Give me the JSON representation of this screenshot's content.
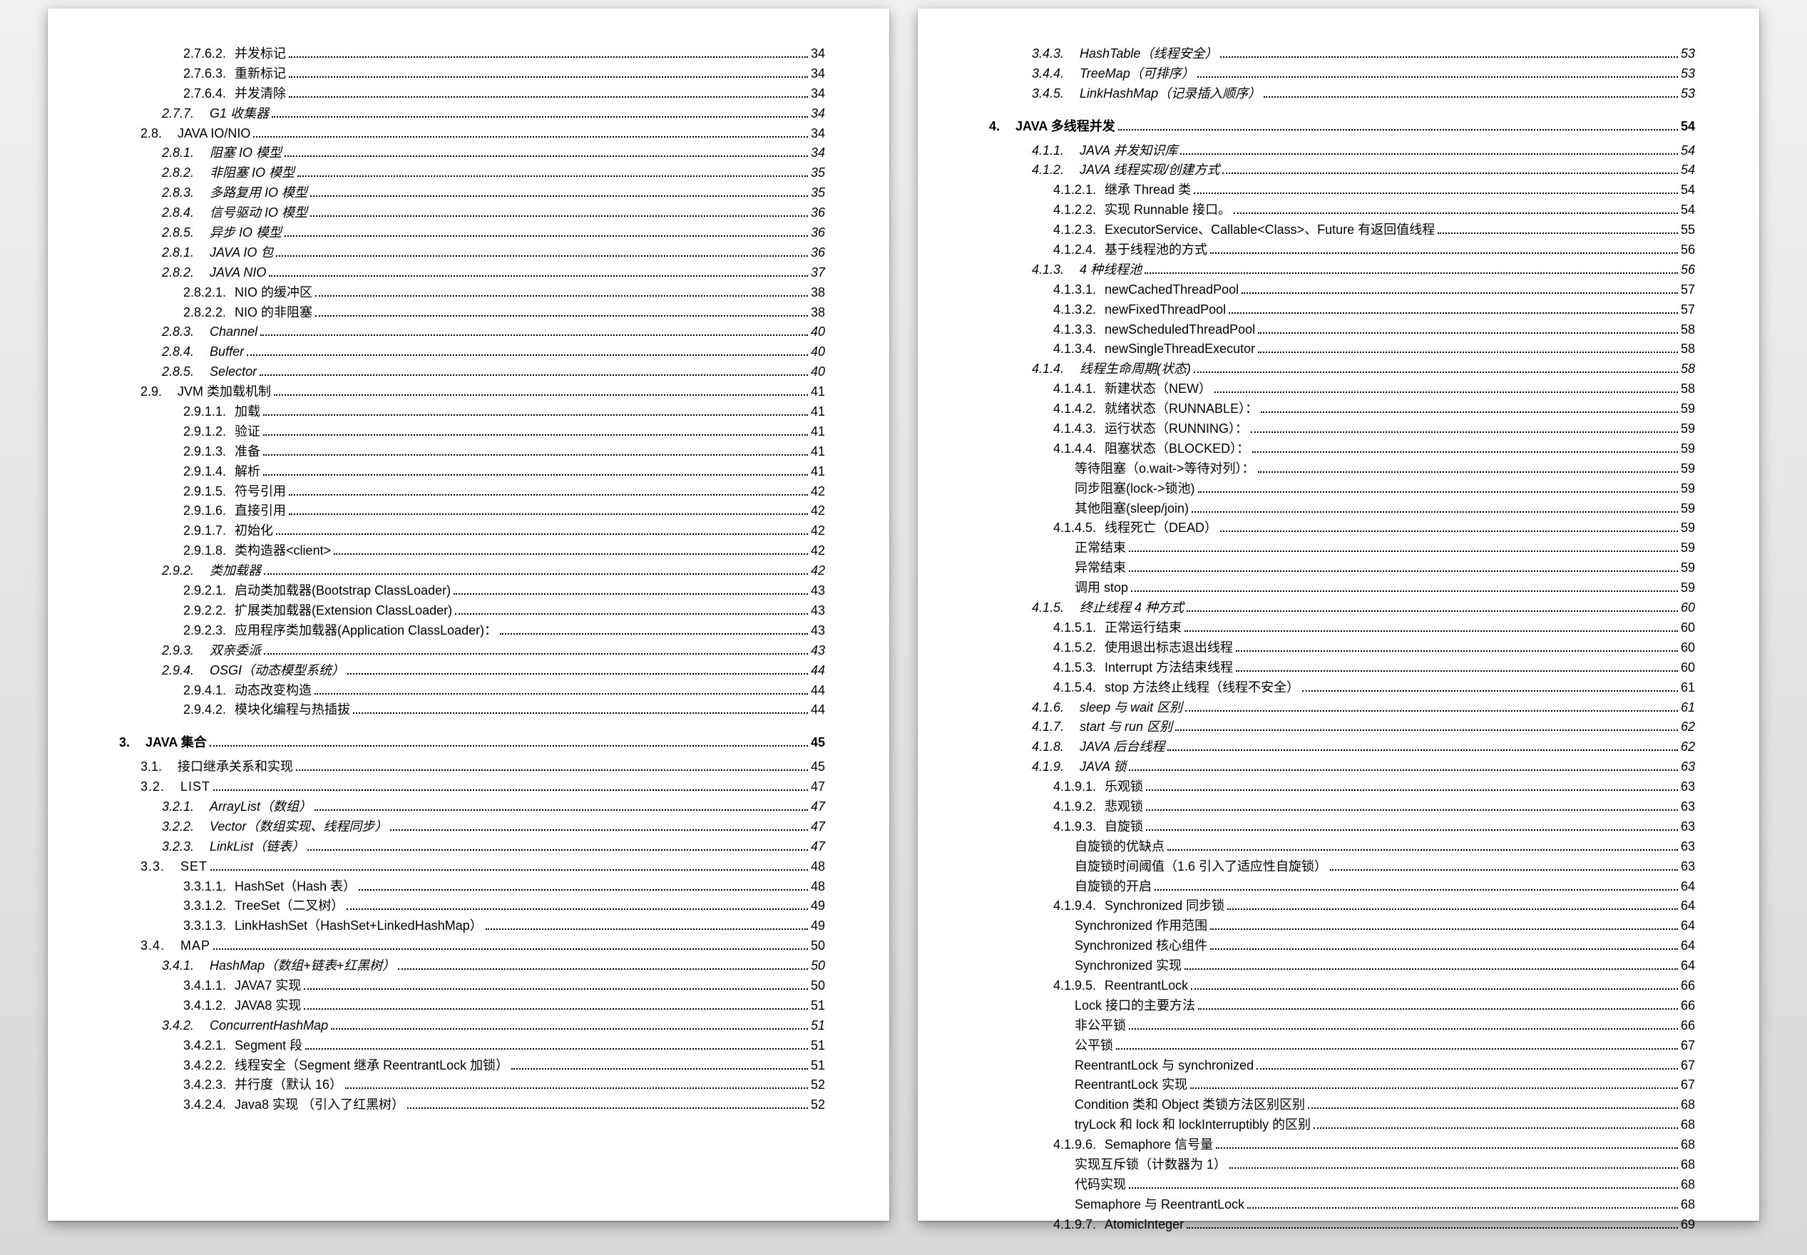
{
  "left": [
    {
      "indent": 3,
      "num": "2.7.6.2.",
      "label": "并发标记",
      "page": "34",
      "italic": false,
      "bold": false
    },
    {
      "indent": 3,
      "num": "2.7.6.3.",
      "label": "重新标记",
      "page": "34",
      "italic": false,
      "bold": false
    },
    {
      "indent": 3,
      "num": "2.7.6.4.",
      "label": "并发清除",
      "page": "34",
      "italic": false,
      "bold": false
    },
    {
      "indent": 2,
      "num": "2.7.7.",
      "label": "G1 收集器",
      "page": "34",
      "italic": true,
      "bold": false
    },
    {
      "indent": 1,
      "num": "2.8.",
      "label": "JAVA IO/NIO",
      "page": "34",
      "italic": false,
      "bold": false
    },
    {
      "indent": 2,
      "num": "2.8.1.",
      "label": "阻塞 IO 模型",
      "page": "34",
      "italic": true,
      "bold": false
    },
    {
      "indent": 2,
      "num": "2.8.2.",
      "label": "非阻塞 IO 模型",
      "page": "35",
      "italic": true,
      "bold": false
    },
    {
      "indent": 2,
      "num": "2.8.3.",
      "label": "多路复用 IO 模型",
      "page": "35",
      "italic": true,
      "bold": false
    },
    {
      "indent": 2,
      "num": "2.8.4.",
      "label": "信号驱动 IO 模型",
      "page": "36",
      "italic": true,
      "bold": false
    },
    {
      "indent": 2,
      "num": "2.8.5.",
      "label": "异步 IO 模型",
      "page": "36",
      "italic": true,
      "bold": false
    },
    {
      "indent": 2,
      "num": "2.8.1.",
      "label": "JAVA IO 包",
      "page": "36",
      "italic": true,
      "bold": false
    },
    {
      "indent": 2,
      "num": "2.8.2.",
      "label": "JAVA NIO",
      "page": "37",
      "italic": true,
      "bold": false
    },
    {
      "indent": 3,
      "num": "2.8.2.1.",
      "label": "NIO 的缓冲区",
      "page": "38",
      "italic": false,
      "bold": false
    },
    {
      "indent": 3,
      "num": "2.8.2.2.",
      "label": "NIO 的非阻塞",
      "page": "38",
      "italic": false,
      "bold": false
    },
    {
      "indent": 2,
      "num": "2.8.3.",
      "label": "Channel",
      "page": "40",
      "italic": true,
      "bold": false
    },
    {
      "indent": 2,
      "num": "2.8.4.",
      "label": "Buffer",
      "page": "40",
      "italic": true,
      "bold": false
    },
    {
      "indent": 2,
      "num": "2.8.5.",
      "label": "Selector",
      "page": "40",
      "italic": true,
      "bold": false
    },
    {
      "indent": 1,
      "num": "2.9.",
      "label": "JVM 类加载机制",
      "page": "41",
      "italic": false,
      "bold": false
    },
    {
      "indent": 3,
      "num": "2.9.1.1.",
      "label": "加载",
      "page": "41",
      "italic": false,
      "bold": false
    },
    {
      "indent": 3,
      "num": "2.9.1.2.",
      "label": "验证",
      "page": "41",
      "italic": false,
      "bold": false
    },
    {
      "indent": 3,
      "num": "2.9.1.3.",
      "label": "准备",
      "page": "41",
      "italic": false,
      "bold": false
    },
    {
      "indent": 3,
      "num": "2.9.1.4.",
      "label": "解析",
      "page": "41",
      "italic": false,
      "bold": false
    },
    {
      "indent": 3,
      "num": "2.9.1.5.",
      "label": "符号引用",
      "page": "42",
      "italic": false,
      "bold": false
    },
    {
      "indent": 3,
      "num": "2.9.1.6.",
      "label": "直接引用",
      "page": "42",
      "italic": false,
      "bold": false
    },
    {
      "indent": 3,
      "num": "2.9.1.7.",
      "label": "初始化",
      "page": "42",
      "italic": false,
      "bold": false
    },
    {
      "indent": 3,
      "num": "2.9.1.8.",
      "label": "类构造器<client>",
      "page": "42",
      "italic": false,
      "bold": false
    },
    {
      "indent": 2,
      "num": "2.9.2.",
      "label": "类加载器",
      "page": "42",
      "italic": true,
      "bold": false
    },
    {
      "indent": 3,
      "num": "2.9.2.1.",
      "label": "启动类加载器(Bootstrap ClassLoader)",
      "page": "43",
      "italic": false,
      "bold": false
    },
    {
      "indent": 3,
      "num": "2.9.2.2.",
      "label": "扩展类加载器(Extension ClassLoader)",
      "page": "43",
      "italic": false,
      "bold": false
    },
    {
      "indent": 3,
      "num": "2.9.2.3.",
      "label": "应用程序类加载器(Application ClassLoader)：",
      "page": "43",
      "italic": false,
      "bold": false
    },
    {
      "indent": 2,
      "num": "2.9.3.",
      "label": "双亲委派",
      "page": "43",
      "italic": true,
      "bold": false
    },
    {
      "indent": 2,
      "num": "2.9.4.",
      "label": "OSGI（动态模型系统）",
      "page": "44",
      "italic": true,
      "bold": false
    },
    {
      "indent": 3,
      "num": "2.9.4.1.",
      "label": "动态改变构造",
      "page": "44",
      "italic": false,
      "bold": false
    },
    {
      "indent": 3,
      "num": "2.9.4.2.",
      "label": "模块化编程与热插拔",
      "page": "44",
      "italic": false,
      "bold": false
    },
    {
      "indent": 0,
      "num": "3.",
      "label": "JAVA 集合",
      "page": "45",
      "italic": false,
      "bold": true
    },
    {
      "indent": 1,
      "num": "3.1.",
      "label": "接口继承关系和实现",
      "page": "45",
      "italic": false,
      "bold": false
    },
    {
      "indent": 1,
      "num": "3.2.",
      "label": "LIST",
      "page": "47",
      "italic": false,
      "bold": false,
      "smallcaps": true
    },
    {
      "indent": 2,
      "num": "3.2.1.",
      "label": "ArrayList（数组）",
      "page": "47",
      "italic": true,
      "bold": false
    },
    {
      "indent": 2,
      "num": "3.2.2.",
      "label": "Vector（数组实现、线程同步）",
      "page": "47",
      "italic": true,
      "bold": false
    },
    {
      "indent": 2,
      "num": "3.2.3.",
      "label": "LinkList（链表）",
      "page": "47",
      "italic": true,
      "bold": false
    },
    {
      "indent": 1,
      "num": "3.3.",
      "label": "SET",
      "page": "48",
      "italic": false,
      "bold": false,
      "smallcaps": true
    },
    {
      "indent": 3,
      "num": "3.3.1.1.",
      "label": "HashSet（Hash 表）",
      "page": "48",
      "italic": false,
      "bold": false
    },
    {
      "indent": 3,
      "num": "3.3.1.2.",
      "label": "TreeSet（二叉树）",
      "page": "49",
      "italic": false,
      "bold": false
    },
    {
      "indent": 3,
      "num": "3.3.1.3.",
      "label": "LinkHashSet（HashSet+LinkedHashMap）",
      "page": "49",
      "italic": false,
      "bold": false
    },
    {
      "indent": 1,
      "num": "3.4.",
      "label": "MAP",
      "page": "50",
      "italic": false,
      "bold": false,
      "smallcaps": true
    },
    {
      "indent": 2,
      "num": "3.4.1.",
      "label": "HashMap（数组+链表+红黑树）",
      "page": "50",
      "italic": true,
      "bold": false
    },
    {
      "indent": 3,
      "num": "3.4.1.1.",
      "label": "JAVA7 实现",
      "page": "50",
      "italic": false,
      "bold": false
    },
    {
      "indent": 3,
      "num": "3.4.1.2.",
      "label": "JAVA8 实现",
      "page": "51",
      "italic": false,
      "bold": false
    },
    {
      "indent": 2,
      "num": "3.4.2.",
      "label": "ConcurrentHashMap",
      "page": "51",
      "italic": true,
      "bold": false
    },
    {
      "indent": 3,
      "num": "3.4.2.1.",
      "label": "Segment 段",
      "page": "51",
      "italic": false,
      "bold": false
    },
    {
      "indent": 3,
      "num": "3.4.2.2.",
      "label": "线程安全（Segment 继承 ReentrantLock 加锁）",
      "page": "51",
      "italic": false,
      "bold": false
    },
    {
      "indent": 3,
      "num": "3.4.2.3.",
      "label": "并行度（默认 16）",
      "page": "52",
      "italic": false,
      "bold": false
    },
    {
      "indent": 3,
      "num": "3.4.2.4.",
      "label": "Java8 实现 （引入了红黑树）",
      "page": "52",
      "italic": false,
      "bold": false
    }
  ],
  "right": [
    {
      "indent": 2,
      "num": "3.4.3.",
      "label": "HashTable（线程安全）",
      "page": "53",
      "italic": true,
      "bold": false
    },
    {
      "indent": 2,
      "num": "3.4.4.",
      "label": "TreeMap（可排序）",
      "page": "53",
      "italic": true,
      "bold": false
    },
    {
      "indent": 2,
      "num": "3.4.5.",
      "label": "LinkHashMap（记录插入顺序）",
      "page": "53",
      "italic": true,
      "bold": false
    },
    {
      "indent": 0,
      "num": "4.",
      "label": "JAVA 多线程并发",
      "page": "54",
      "italic": false,
      "bold": true
    },
    {
      "indent": 2,
      "num": "4.1.1.",
      "label": "JAVA 并发知识库",
      "page": "54",
      "italic": true,
      "bold": false
    },
    {
      "indent": 2,
      "num": "4.1.2.",
      "label": "JAVA 线程实现/创建方式",
      "page": "54",
      "italic": true,
      "bold": false
    },
    {
      "indent": 3,
      "num": "4.1.2.1.",
      "label": "继承 Thread 类",
      "page": "54",
      "italic": false,
      "bold": false
    },
    {
      "indent": 3,
      "num": "4.1.2.2.",
      "label": "实现 Runnable 接口。",
      "page": "54",
      "italic": false,
      "bold": false
    },
    {
      "indent": 3,
      "num": "4.1.2.3.",
      "label": "ExecutorService、Callable<Class>、Future 有返回值线程",
      "page": "55",
      "italic": false,
      "bold": false
    },
    {
      "indent": 3,
      "num": "4.1.2.4.",
      "label": "基于线程池的方式",
      "page": "56",
      "italic": false,
      "bold": false
    },
    {
      "indent": 2,
      "num": "4.1.3.",
      "label": "4 种线程池",
      "page": "56",
      "italic": true,
      "bold": false
    },
    {
      "indent": 3,
      "num": "4.1.3.1.",
      "label": "newCachedThreadPool",
      "page": "57",
      "italic": false,
      "bold": false
    },
    {
      "indent": 3,
      "num": "4.1.3.2.",
      "label": "newFixedThreadPool",
      "page": "57",
      "italic": false,
      "bold": false
    },
    {
      "indent": 3,
      "num": "4.1.3.3.",
      "label": "newScheduledThreadPool",
      "page": "58",
      "italic": false,
      "bold": false
    },
    {
      "indent": 3,
      "num": "4.1.3.4.",
      "label": "newSingleThreadExecutor",
      "page": "58",
      "italic": false,
      "bold": false
    },
    {
      "indent": 2,
      "num": "4.1.4.",
      "label": "线程生命周期(状态)",
      "page": "58",
      "italic": true,
      "bold": false
    },
    {
      "indent": 3,
      "num": "4.1.4.1.",
      "label": "新建状态（NEW）",
      "page": "58",
      "italic": false,
      "bold": false
    },
    {
      "indent": 3,
      "num": "4.1.4.2.",
      "label": "就绪状态（RUNNABLE）：",
      "page": "59",
      "italic": false,
      "bold": false
    },
    {
      "indent": 3,
      "num": "4.1.4.3.",
      "label": "运行状态（RUNNING）：",
      "page": "59",
      "italic": false,
      "bold": false
    },
    {
      "indent": 3,
      "num": "4.1.4.4.",
      "label": "阻塞状态（BLOCKED）：",
      "page": "59",
      "italic": false,
      "bold": false
    },
    {
      "indent": 4,
      "num": "",
      "label": "等待阻塞（o.wait->等待对列）：",
      "page": "59",
      "italic": false,
      "bold": false
    },
    {
      "indent": 4,
      "num": "",
      "label": "同步阻塞(lock->锁池)",
      "page": "59",
      "italic": false,
      "bold": false
    },
    {
      "indent": 4,
      "num": "",
      "label": "其他阻塞(sleep/join)",
      "page": "59",
      "italic": false,
      "bold": false
    },
    {
      "indent": 3,
      "num": "4.1.4.5.",
      "label": "线程死亡（DEAD）",
      "page": "59",
      "italic": false,
      "bold": false
    },
    {
      "indent": 4,
      "num": "",
      "label": "正常结束",
      "page": "59",
      "italic": false,
      "bold": false
    },
    {
      "indent": 4,
      "num": "",
      "label": "异常结束",
      "page": "59",
      "italic": false,
      "bold": false
    },
    {
      "indent": 4,
      "num": "",
      "label": "调用 stop",
      "page": "59",
      "italic": false,
      "bold": false
    },
    {
      "indent": 2,
      "num": "4.1.5.",
      "label": "终止线程 4 种方式",
      "page": "60",
      "italic": true,
      "bold": false
    },
    {
      "indent": 3,
      "num": "4.1.5.1.",
      "label": "正常运行结束",
      "page": "60",
      "italic": false,
      "bold": false
    },
    {
      "indent": 3,
      "num": "4.1.5.2.",
      "label": "使用退出标志退出线程",
      "page": "60",
      "italic": false,
      "bold": false
    },
    {
      "indent": 3,
      "num": "4.1.5.3.",
      "label": "Interrupt 方法结束线程",
      "page": "60",
      "italic": false,
      "bold": false
    },
    {
      "indent": 3,
      "num": "4.1.5.4.",
      "label": "stop 方法终止线程（线程不安全）",
      "page": "61",
      "italic": false,
      "bold": false
    },
    {
      "indent": 2,
      "num": "4.1.6.",
      "label": "sleep 与 wait 区别",
      "page": "61",
      "italic": true,
      "bold": false
    },
    {
      "indent": 2,
      "num": "4.1.7.",
      "label": "start 与 run 区别",
      "page": "62",
      "italic": true,
      "bold": false
    },
    {
      "indent": 2,
      "num": "4.1.8.",
      "label": "JAVA 后台线程",
      "page": "62",
      "italic": true,
      "bold": false
    },
    {
      "indent": 2,
      "num": "4.1.9.",
      "label": "JAVA 锁",
      "page": "63",
      "italic": true,
      "bold": false
    },
    {
      "indent": 3,
      "num": "4.1.9.1.",
      "label": "乐观锁",
      "page": "63",
      "italic": false,
      "bold": false
    },
    {
      "indent": 3,
      "num": "4.1.9.2.",
      "label": "悲观锁",
      "page": "63",
      "italic": false,
      "bold": false
    },
    {
      "indent": 3,
      "num": "4.1.9.3.",
      "label": "自旋锁",
      "page": "63",
      "italic": false,
      "bold": false
    },
    {
      "indent": 4,
      "num": "",
      "label": "自旋锁的优缺点",
      "page": "63",
      "italic": false,
      "bold": false
    },
    {
      "indent": 4,
      "num": "",
      "label": "自旋锁时间阈值（1.6 引入了适应性自旋锁）",
      "page": "63",
      "italic": false,
      "bold": false
    },
    {
      "indent": 4,
      "num": "",
      "label": "自旋锁的开启",
      "page": "64",
      "italic": false,
      "bold": false
    },
    {
      "indent": 3,
      "num": "4.1.9.4.",
      "label": "Synchronized 同步锁",
      "page": "64",
      "italic": false,
      "bold": false
    },
    {
      "indent": 4,
      "num": "",
      "label": "Synchronized 作用范围",
      "page": "64",
      "italic": false,
      "bold": false
    },
    {
      "indent": 4,
      "num": "",
      "label": "Synchronized 核心组件",
      "page": "64",
      "italic": false,
      "bold": false
    },
    {
      "indent": 4,
      "num": "",
      "label": "Synchronized 实现",
      "page": "64",
      "italic": false,
      "bold": false
    },
    {
      "indent": 3,
      "num": "4.1.9.5.",
      "label": "ReentrantLock",
      "page": "66",
      "italic": false,
      "bold": false
    },
    {
      "indent": 4,
      "num": "",
      "label": "Lock 接口的主要方法",
      "page": "66",
      "italic": false,
      "bold": false
    },
    {
      "indent": 4,
      "num": "",
      "label": "非公平锁",
      "page": "66",
      "italic": false,
      "bold": false
    },
    {
      "indent": 4,
      "num": "",
      "label": "公平锁",
      "page": "67",
      "italic": false,
      "bold": false
    },
    {
      "indent": 4,
      "num": "",
      "label": "ReentrantLock 与 synchronized",
      "page": "67",
      "italic": false,
      "bold": false
    },
    {
      "indent": 4,
      "num": "",
      "label": "ReentrantLock 实现",
      "page": "67",
      "italic": false,
      "bold": false
    },
    {
      "indent": 4,
      "num": "",
      "label": "Condition 类和 Object 类锁方法区别区别",
      "page": "68",
      "italic": false,
      "bold": false
    },
    {
      "indent": 4,
      "num": "",
      "label": "tryLock 和 lock 和 lockInterruptibly 的区别",
      "page": "68",
      "italic": false,
      "bold": false
    },
    {
      "indent": 3,
      "num": "4.1.9.6.",
      "label": "Semaphore 信号量",
      "page": "68",
      "italic": false,
      "bold": false
    },
    {
      "indent": 4,
      "num": "",
      "label": "实现互斥锁（计数器为 1）",
      "page": "68",
      "italic": false,
      "bold": false
    },
    {
      "indent": 4,
      "num": "",
      "label": "代码实现",
      "page": "68",
      "italic": false,
      "bold": false
    },
    {
      "indent": 4,
      "num": "",
      "label": "Semaphore 与 ReentrantLock",
      "page": "68",
      "italic": false,
      "bold": false
    },
    {
      "indent": 3,
      "num": "4.1.9.7.",
      "label": "AtomicInteger",
      "page": "69",
      "italic": false,
      "bold": false
    }
  ]
}
